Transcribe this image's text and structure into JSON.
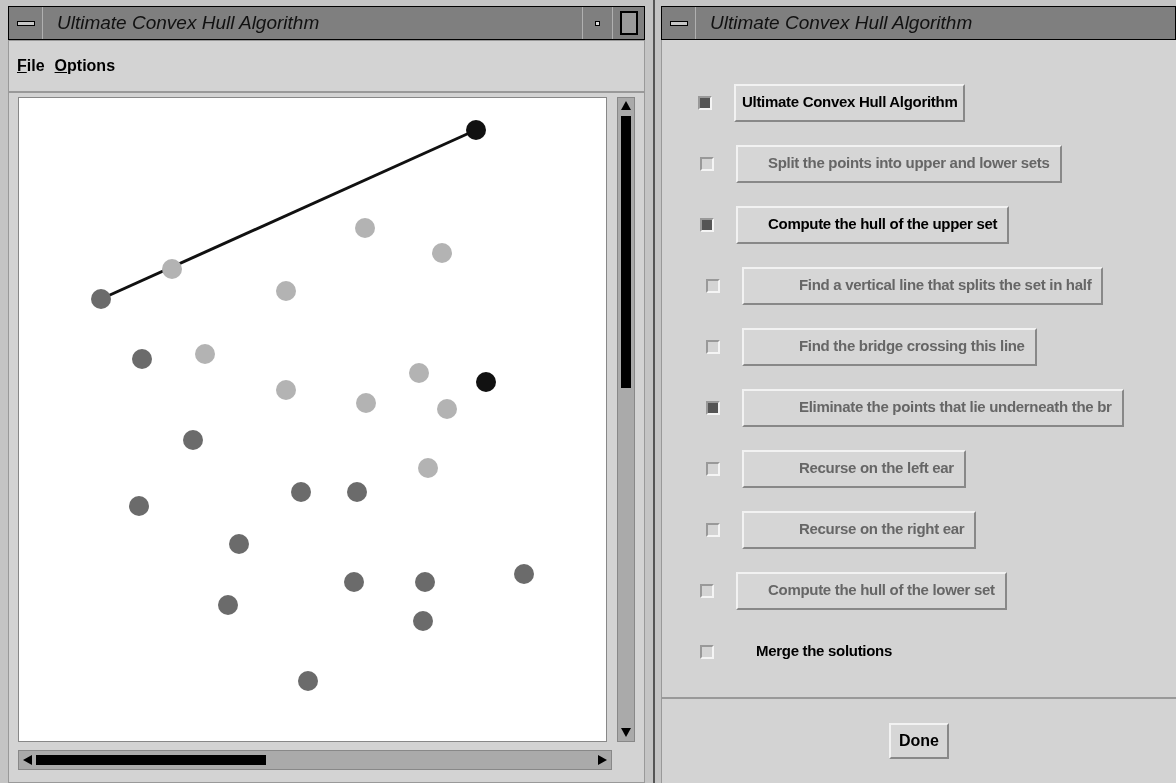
{
  "canvas_window": {
    "title": "Ultimate Convex Hull Algorithm",
    "menu": [
      {
        "label": "File"
      },
      {
        "label": "Options"
      }
    ]
  },
  "steps_window": {
    "title": "Ultimate Convex Hull Algorithm",
    "steps": [
      {
        "label": "Ultimate Convex Hull Algorithm",
        "kind": "button",
        "checked": true,
        "enabled": true,
        "children": [
          {
            "label": "Split the points into upper and lower sets",
            "kind": "button",
            "checked": false,
            "enabled": false
          },
          {
            "label": "Compute the hull of the upper set",
            "kind": "button",
            "checked": true,
            "enabled": true,
            "children": [
              {
                "label": "Find a vertical line that splits the set in half",
                "kind": "button",
                "checked": false,
                "enabled": false
              },
              {
                "label": "Find the bridge crossing this line",
                "kind": "button",
                "checked": false,
                "enabled": false
              },
              {
                "label": "Eliminate the points that lie underneath the br",
                "kind": "button",
                "checked": true,
                "enabled": false
              },
              {
                "label": "Recurse on the left ear",
                "kind": "button",
                "checked": false,
                "enabled": false
              },
              {
                "label": "Recurse on the right ear",
                "kind": "button",
                "checked": false,
                "enabled": false
              }
            ]
          },
          {
            "label": "Compute the hull of the lower set",
            "kind": "button",
            "checked": false,
            "enabled": false
          },
          {
            "label": "Merge the solutions",
            "kind": "label",
            "checked": false,
            "enabled": true
          }
        ]
      }
    ],
    "done_button": "Done"
  }
}
